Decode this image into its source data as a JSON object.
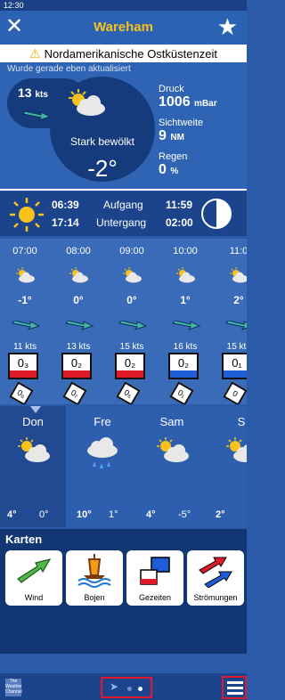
{
  "status": {
    "time": "12:30"
  },
  "header": {
    "title": "Wareham",
    "close_icon": "close-icon",
    "favorite_icon": "star-icon"
  },
  "alert": {
    "text": "Nordamerikanische Ostküstenzeit",
    "icon": "warning-icon"
  },
  "current": {
    "updated": "Wurde gerade eben aktualisiert",
    "wind_speed": "13",
    "wind_unit": "kts",
    "description": "Stark bewölkt",
    "temperature": "-2°",
    "pressure_label": "Druck",
    "pressure_value": "1006",
    "pressure_unit": "mBar",
    "visibility_label": "Sichtweite",
    "visibility_value": "9",
    "visibility_unit": "NM",
    "rain_label": "Regen",
    "rain_value": "0",
    "rain_unit": "%"
  },
  "sun": {
    "sunrise": "06:39",
    "sunset": "17:14",
    "rise_label": "Aufgang",
    "set_label": "Untergang",
    "moonrise": "11:59",
    "moonset": "02:00"
  },
  "hourly": [
    {
      "time": "07:00",
      "temp": "-1°",
      "kts": "11 kts",
      "tide": "0₃",
      "current": "0₉",
      "tide_color": "#e0192a"
    },
    {
      "time": "08:00",
      "temp": "0°",
      "kts": "13 kts",
      "tide": "0₂",
      "current": "0₇",
      "tide_color": "#e0192a"
    },
    {
      "time": "09:00",
      "temp": "0°",
      "kts": "15 kts",
      "tide": "0₂",
      "current": "0₅",
      "tide_color": "#e0192a"
    },
    {
      "time": "10:00",
      "temp": "1°",
      "kts": "16 kts",
      "tide": "0₂",
      "current": "0₁",
      "tide_color": "#1f5cd8"
    },
    {
      "time": "11:0",
      "temp": "2°",
      "kts": "15 kts",
      "tide": "0₁",
      "current": "0",
      "tide_color": "#1f5cd8"
    }
  ],
  "daily": [
    {
      "day": "Don",
      "hi": "4°",
      "lo": "0°"
    },
    {
      "day": "Fre",
      "hi": "10°",
      "lo": "1°"
    },
    {
      "day": "Sam",
      "hi": "4°",
      "lo": "-5°"
    },
    {
      "day": "S",
      "hi": "2°",
      "lo": ""
    }
  ],
  "karten": {
    "heading": "Karten",
    "cards": [
      {
        "label": "Wind",
        "icon": "wind-map-icon"
      },
      {
        "label": "Bojen",
        "icon": "buoy-icon"
      },
      {
        "label": "Gezeiten",
        "icon": "tides-icon"
      },
      {
        "label": "Strömungen",
        "icon": "currents-icon"
      }
    ]
  },
  "bottom": {
    "logo_text": "The Weather Channel",
    "menu_icon": "menu-icon",
    "location_icon": "location-arrow-icon"
  }
}
